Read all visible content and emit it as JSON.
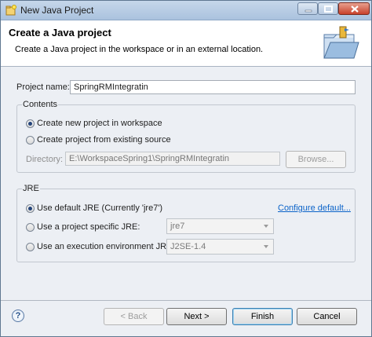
{
  "window": {
    "title": "New Java Project"
  },
  "banner": {
    "title": "Create a Java project",
    "description": "Create a Java project in the workspace or in an external location.",
    "icon": "java-project-folder-icon"
  },
  "project_name": {
    "label": "Project name:",
    "value": "SpringRMIntegratin"
  },
  "contents": {
    "group_label": "Contents",
    "option_new": "Create new project in workspace",
    "option_existing": "Create project from existing source",
    "selected": "option_new",
    "directory_label": "Directory:",
    "directory_value": "E:\\WorkspaceSpring1\\SpringRMIntegratin",
    "browse_label": "Browse..."
  },
  "jre": {
    "group_label": "JRE",
    "option_default": "Use default JRE (Currently 'jre7')",
    "option_specific": "Use a project specific JRE:",
    "option_env": "Use an execution environment JRE:",
    "selected": "option_default",
    "configure_link": "Configure default...",
    "specific_value": "jre7",
    "env_value": "J2SE-1.4"
  },
  "buttons": {
    "help": "?",
    "back": "< Back",
    "next": "Next >",
    "finish": "Finish",
    "cancel": "Cancel"
  },
  "colors": {
    "link": "#0b63c9",
    "titlebar": "#b6cbe3",
    "close": "#c8412b"
  }
}
